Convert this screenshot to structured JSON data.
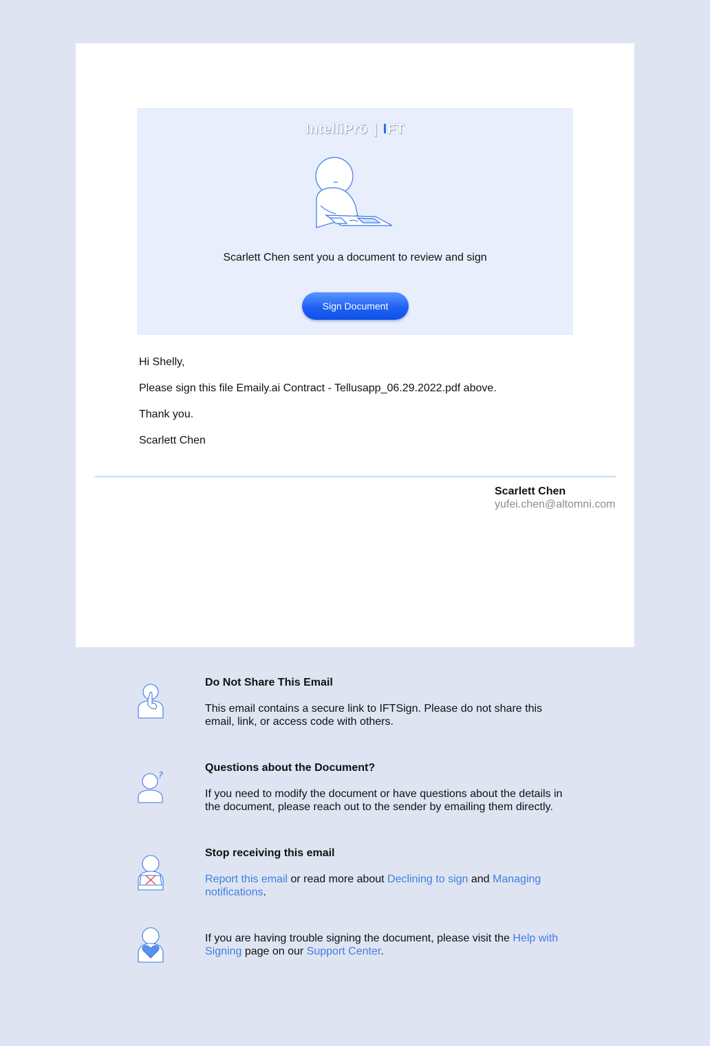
{
  "hero": {
    "brand_left": "IntelliPrō",
    "brand_right_i": "I",
    "brand_right_rest": "FT",
    "message": "Scarlett Chen sent you a document to review and sign",
    "button_label": "Sign Document"
  },
  "email_body": {
    "greeting": "Hi Shelly,",
    "request": "Please sign this file Emaily.ai Contract - Tellusapp_06.29.2022.pdf above.",
    "thanks": "Thank you.",
    "sign_off": "Scarlett Chen"
  },
  "signature": {
    "name": "Scarlett Chen",
    "email": "yufei.chen@altomni.com"
  },
  "footer": {
    "share": {
      "title": "Do Not Share This Email",
      "text": "This email contains a secure link to IFTSign. Please do not share this email, link, or access code with others.",
      "icon": "hush-person-icon"
    },
    "questions": {
      "title": "Questions about the Document?",
      "text": "If you need to modify the document or have questions about the details in the document, please reach out to the sender by emailing them directly.",
      "icon": "question-person-icon"
    },
    "stop": {
      "title": "Stop receiving this email",
      "link_report": "Report this email",
      "text_mid1": " or read more about ",
      "link_declining": "Declining to sign",
      "text_mid2": " and ",
      "link_managing": "Managing notifications",
      "text_end": ".",
      "icon": "declined-person-icon"
    },
    "help": {
      "text_start": "If you are having trouble signing the document, please visit the ",
      "link_help": "Help with Signing",
      "text_mid": " page on our ",
      "link_support": "Support Center",
      "text_end": ".",
      "icon": "heart-person-icon"
    }
  },
  "colors": {
    "background": "#dfe4f2",
    "hero_background": "#e8eefb",
    "accent": "#1f61f5",
    "link": "#3e7fe0",
    "divider": "#c6e2f3",
    "muted": "#8c8c8c"
  }
}
